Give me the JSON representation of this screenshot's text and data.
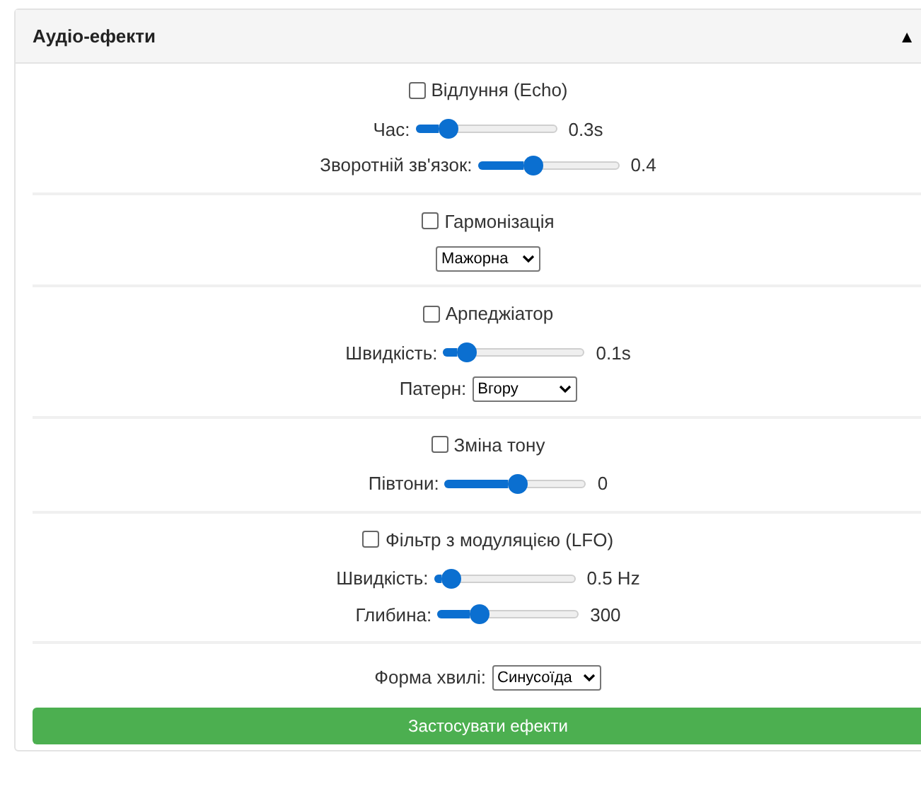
{
  "panel": {
    "title": "Аудіо-ефекти",
    "toggle": "▲",
    "expanded": true
  },
  "sections": [
    {
      "checkbox": {
        "label": "Відлуння (Echo)",
        "checked": false
      },
      "controls": [
        {
          "kind": "slider",
          "label": "Час:",
          "level": 0.23,
          "reading": "0.3s"
        },
        {
          "kind": "slider",
          "label": "Зворотній зв'язок:",
          "level": 0.39,
          "reading": "0.4"
        }
      ]
    },
    {
      "checkbox": {
        "label": "Гармонізація",
        "checked": false
      },
      "controls": [
        {
          "kind": "select",
          "value": "Мажорна"
        }
      ]
    },
    {
      "checkbox": {
        "label": "Арпеджіатор",
        "checked": false
      },
      "controls": [
        {
          "kind": "slider",
          "label": "Швидкість:",
          "level": 0.16,
          "reading": "0.1s"
        },
        {
          "kind": "select",
          "label": "Патерн:",
          "value": "Вгору"
        }
      ]
    },
    {
      "checkbox": {
        "label": "Зміна тону",
        "checked": false
      },
      "controls": [
        {
          "kind": "slider",
          "label": "Півтони:",
          "level": 0.52,
          "reading": "0"
        }
      ]
    },
    {
      "checkbox": {
        "label": "Фільтр з модуляцією (LFO)",
        "checked": false
      },
      "controls": [
        {
          "kind": "slider",
          "label": "Швидкість:",
          "level": 0.11,
          "reading": "0.5 Hz"
        },
        {
          "kind": "slider",
          "label": "Глибина:",
          "level": 0.29,
          "reading": "300"
        }
      ]
    },
    {
      "controls": [
        {
          "kind": "select",
          "label": "Форма хвилі:",
          "value": "Синусоїда"
        }
      ]
    }
  ],
  "apply_button": "Застосувати ефекти"
}
